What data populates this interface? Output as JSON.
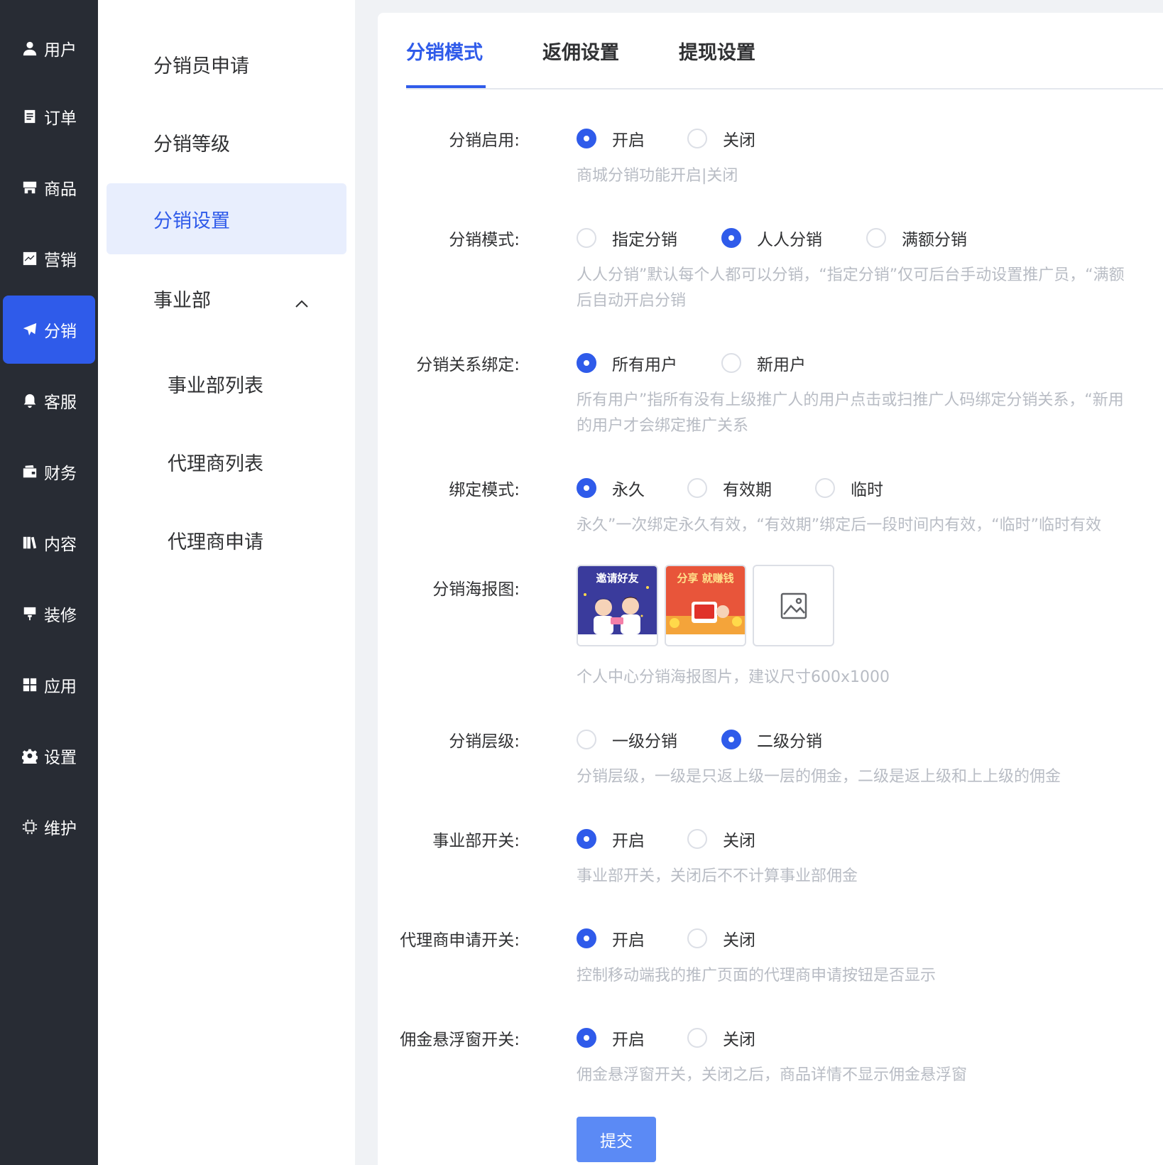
{
  "main_nav": [
    {
      "label": "用户",
      "icon": "user-icon"
    },
    {
      "label": "订单",
      "icon": "order-icon"
    },
    {
      "label": "商品",
      "icon": "store-icon"
    },
    {
      "label": "营销",
      "icon": "chart-icon"
    },
    {
      "label": "分销",
      "icon": "send-icon",
      "active": true
    },
    {
      "label": "客服",
      "icon": "bell-icon"
    },
    {
      "label": "财务",
      "icon": "wallet-icon"
    },
    {
      "label": "内容",
      "icon": "book-icon"
    },
    {
      "label": "装修",
      "icon": "brush-icon"
    },
    {
      "label": "应用",
      "icon": "apps-icon"
    },
    {
      "label": "设置",
      "icon": "gear-icon"
    },
    {
      "label": "维护",
      "icon": "chip-icon"
    }
  ],
  "sub_nav": {
    "items": [
      "分销员申请",
      "分销等级",
      "分销设置",
      "事业部",
      "事业部列表",
      "代理商列表",
      "代理商申请"
    ],
    "active": "分销设置"
  },
  "tabs": [
    "分销模式",
    "返佣设置",
    "提现设置"
  ],
  "active_tab": "分销模式",
  "form": {
    "enable": {
      "label": "分销启用:",
      "options": [
        "开启",
        "关闭"
      ],
      "selected": "开启",
      "help": "商城分销功能开启|关闭"
    },
    "mode": {
      "label": "分销模式:",
      "options": [
        "指定分销",
        "人人分销",
        "满额分销"
      ],
      "selected": "人人分销",
      "help_line1": "人人分销”默认每个人都可以分销，“指定分销”仅可后台手动设置推广员，“满额",
      "help_line2": "后自动开启分销"
    },
    "binding": {
      "label": "分销关系绑定:",
      "options": [
        "所有用户",
        "新用户"
      ],
      "selected": "所有用户",
      "help_line1": "所有用户”指所有没有上级推广人的用户点击或扫推广人码绑定分销关系，“新用",
      "help_line2": "的用户才会绑定推广关系"
    },
    "bind_mode": {
      "label": "绑定模式:",
      "options": [
        "永久",
        "有效期",
        "临时"
      ],
      "selected": "永久",
      "help": "永久”一次绑定永久有效，“有效期”绑定后一段时间内有效，“临时”临时有效"
    },
    "poster": {
      "label": "分销海报图:",
      "images": [
        {
          "name": "poster-invite-friends",
          "headline": "邀请好友",
          "bg": "#3a3b9c"
        },
        {
          "name": "poster-share-earn",
          "headline": "分享 就赚钱",
          "bg": "#e8553a"
        }
      ],
      "help": "个人中心分销海报图片，建议尺寸600x1000"
    },
    "level": {
      "label": "分销层级:",
      "options": [
        "一级分销",
        "二级分销"
      ],
      "selected": "二级分销",
      "help": "分销层级，一级是只返上级一层的佣金，二级是返上级和上上级的佣金"
    },
    "division": {
      "label": "事业部开关:",
      "options": [
        "开启",
        "关闭"
      ],
      "selected": "开启",
      "help": "事业部开关，关闭后不不计算事业部佣金"
    },
    "agent": {
      "label": "代理商申请开关:",
      "options": [
        "开启",
        "关闭"
      ],
      "selected": "开启",
      "help": "控制移动端我的推广页面的代理商申请按钮是否显示"
    },
    "float": {
      "label": "佣金悬浮窗开关:",
      "options": [
        "开启",
        "关闭"
      ],
      "selected": "开启",
      "help": "佣金悬浮窗开关，关闭之后，商品详情不显示佣金悬浮窗"
    }
  },
  "submit_label": "提交",
  "colors": {
    "primary": "#2f5bea",
    "nav_bg": "#282c34",
    "submit": "#5b8af5",
    "help_text": "#b8bcc4"
  }
}
